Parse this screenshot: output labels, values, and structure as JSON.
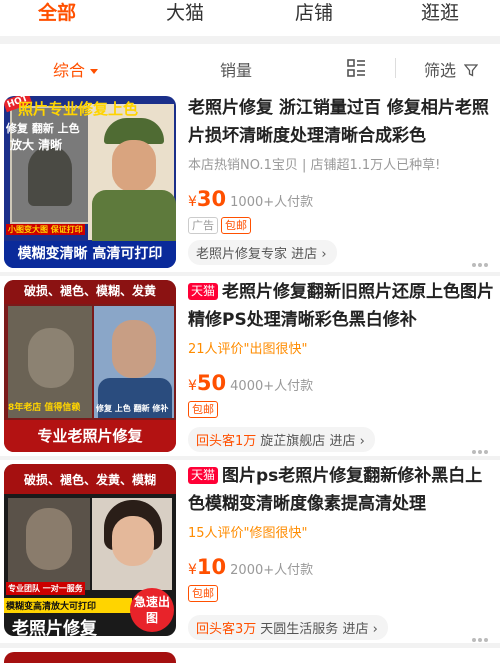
{
  "top_tabs": [
    "全部",
    "大猫",
    "店铺",
    "逛逛"
  ],
  "sort": {
    "comprehensive": "综合",
    "sales": "销量",
    "filter": "筛选"
  },
  "products": [
    {
      "thumb": {
        "hot": "HOT",
        "banner": "照片专业修复上色",
        "line1": "修复 翻新 上色",
        "line2": "放大 清晰",
        "small_note": "小图变大图 保证打印",
        "bottom": "模糊变清晰 高清可打印"
      },
      "title": "老照片修复 浙江销量过百 修复相片老照片损坏清晰度处理清晰合成彩色",
      "sub": "本店热销NO.1宝贝 | 店铺超1.1万人已种草!",
      "yen": "¥",
      "price": "30",
      "paid": "1000+人付款",
      "tags": [
        "广告",
        "包邮"
      ],
      "shop": "老照片修复专家",
      "shop_enter": "进店"
    },
    {
      "thumb": {
        "banner": "破损、褪色、模糊、发黄",
        "years": "8年老店 值得信赖",
        "services": "修复 上色 翻新 修补",
        "bottom": "专业老照片修复"
      },
      "tmall": "天猫",
      "title": "老照片修复翻新旧照片还原上色图片精修PS处理清晰彩色黑白修补",
      "sub": "21人评价\"出图很快\"",
      "yen": "¥",
      "price": "50",
      "paid": "4000+人付款",
      "tags": [
        "包邮"
      ],
      "repeat": "回头客1万",
      "shop": "旋芷旗舰店",
      "shop_enter": "进店"
    },
    {
      "thumb": {
        "banner": "破损、褪色、发黄、模糊",
        "team": "专业团队 一对一服务",
        "bottom_small": "模糊变高清放大可打印",
        "bottom": "老照片修复",
        "urgent": "急速出图"
      },
      "tmall": "天猫",
      "title": "图片ps老照片修复翻新修补黑白上色模糊变清晰度像素提高清处理",
      "sub": "15人评价\"修图很快\"",
      "yen": "¥",
      "price": "10",
      "paid": "2000+人付款",
      "tags": [
        "包邮"
      ],
      "repeat": "回头客3万",
      "shop": "天圆生活服务",
      "shop_enter": "进店"
    }
  ],
  "colors": {
    "accent": "#ff5000",
    "tmall": "#ff0036",
    "hint": "#ff8c00"
  }
}
